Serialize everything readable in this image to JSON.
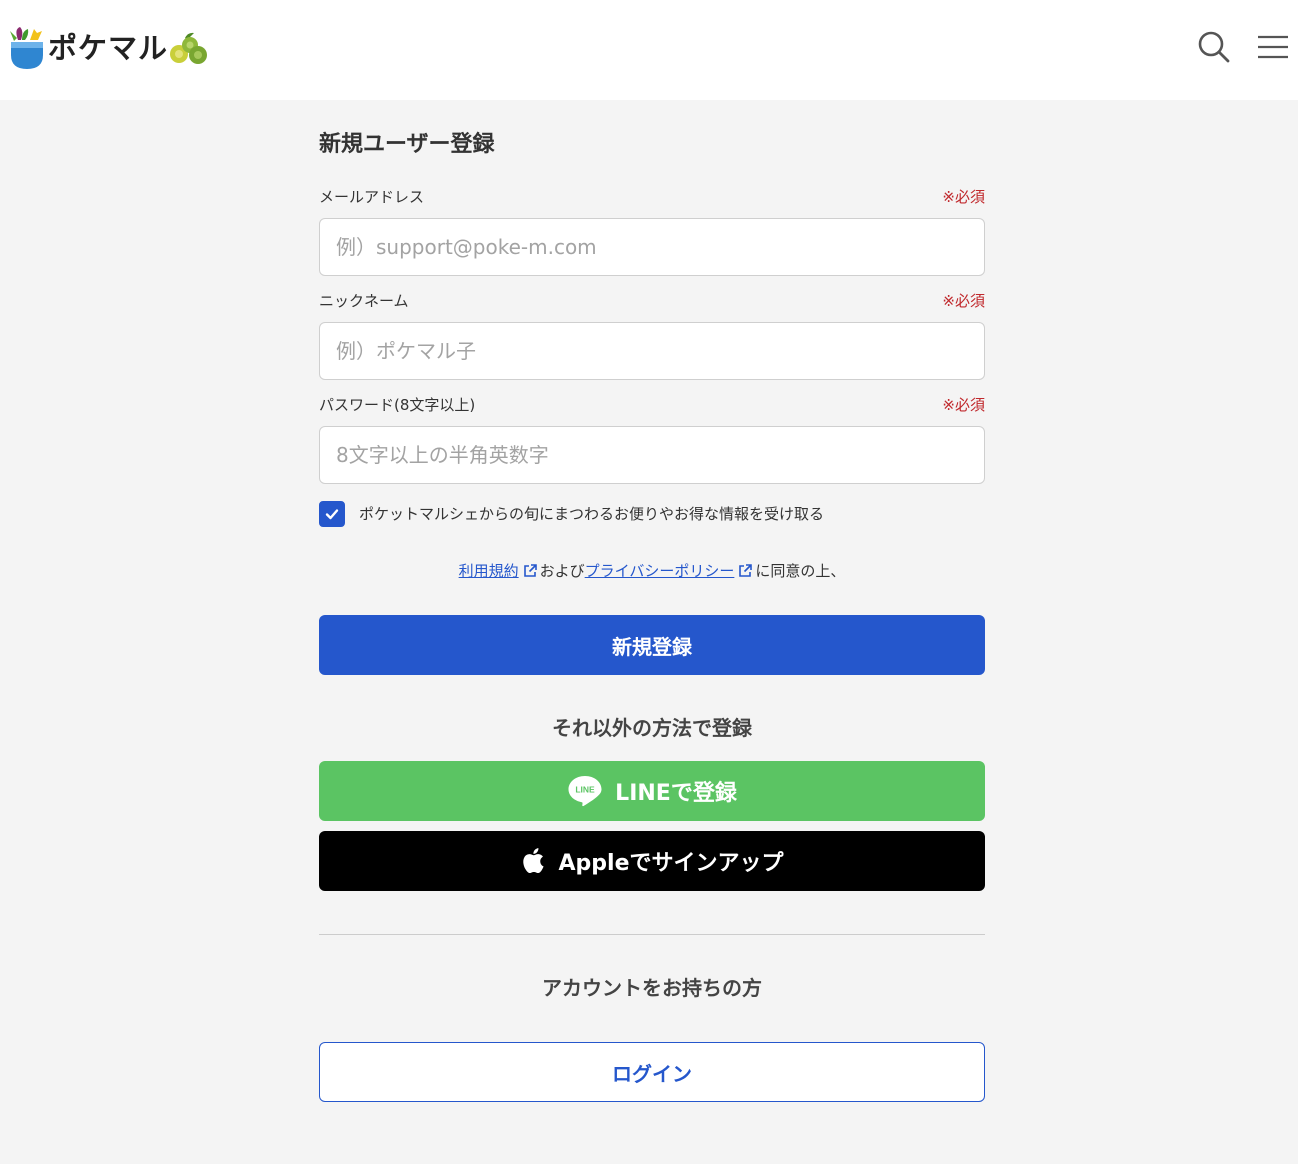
{
  "header": {
    "logo_text": "ポケマル",
    "logo_icon": "pocket-logo-icon",
    "search_icon": "search-icon",
    "menu_icon": "hamburger-menu-icon"
  },
  "form": {
    "title": "新規ユーザー登録",
    "email": {
      "label": "メールアドレス",
      "required": "※必須",
      "placeholder": "例）support@poke-m.com",
      "value": ""
    },
    "nickname": {
      "label": "ニックネーム",
      "required": "※必須",
      "placeholder": "例）ポケマル子",
      "value": ""
    },
    "password": {
      "label": "パスワード(8文字以上)",
      "required": "※必須",
      "placeholder": "8文字以上の半角英数字",
      "value": ""
    },
    "newsletter": {
      "label": "ポケットマルシェからの旬にまつわるお便りやお得な情報を受け取る",
      "checked": true
    },
    "terms": {
      "terms_link": "利用規約",
      "conjunction": "および",
      "privacy_link": "プライバシーポリシー",
      "suffix": "に同意の上、"
    },
    "submit_label": "新規登録"
  },
  "alt_signup": {
    "heading": "それ以外の方法で登録",
    "line_logo_text": "LINE",
    "line_label": "LINEで登録",
    "apple_label": "Appleでサインアップ"
  },
  "login": {
    "heading": "アカウントをお持ちの方",
    "button_label": "ログイン"
  },
  "icons": {
    "search": "search-icon",
    "menu": "hamburger-menu-icon",
    "external_link": "external-link-icon",
    "check": "checkmark-icon",
    "line": "line-logo-icon",
    "apple": "apple-logo-icon"
  },
  "colors": {
    "primary": "#2557cc",
    "line_green": "#5bc463",
    "apple_black": "#000000",
    "required_red": "#c0282c",
    "background": "#f4f4f4"
  }
}
